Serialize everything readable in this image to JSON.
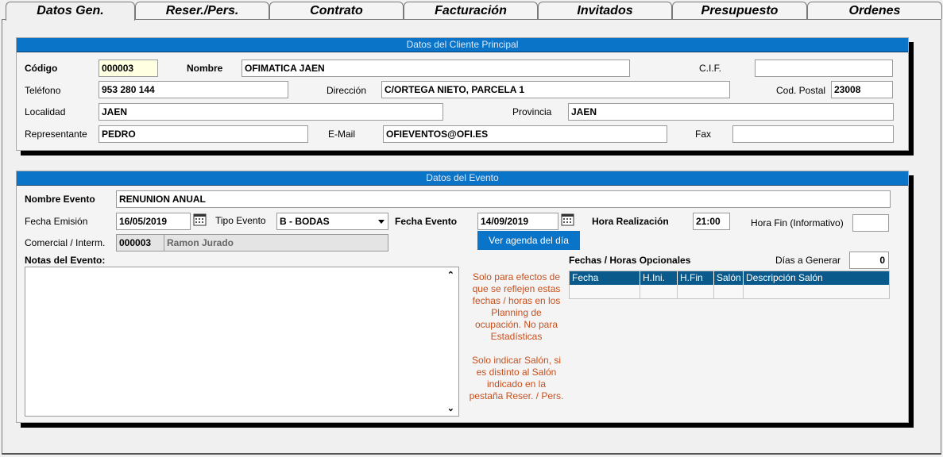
{
  "tabs": [
    "Datos Gen.",
    "Reser./Pers.",
    "Contrato",
    "Facturación",
    "Invitados",
    "Presupuesto",
    "Ordenes"
  ],
  "cliente": {
    "title": "Datos del Cliente Principal",
    "codigo_label": "Código",
    "codigo": "000003",
    "nombre_label": "Nombre",
    "nombre": "OFIMATICA JAEN",
    "cif_label": "C.I.F.",
    "cif": "",
    "telefono_label": "Teléfono",
    "telefono": "953 280 144",
    "direccion_label": "Dirección",
    "direccion": "C/ORTEGA NIETO, PARCELA 1",
    "cp_label": "Cod. Postal",
    "cp": "23008",
    "localidad_label": "Localidad",
    "localidad": "JAEN",
    "provincia_label": "Provincia",
    "provincia": "JAEN",
    "representante_label": "Representante",
    "representante": "PEDRO",
    "email_label": "E-Mail",
    "email": "OFIEVENTOS@OFI.ES",
    "fax_label": "Fax",
    "fax": ""
  },
  "evento": {
    "title": "Datos del Evento",
    "nombre_label": "Nombre Evento",
    "nombre": "RENUNION ANUAL",
    "fecha_emision_label": "Fecha Emisión",
    "fecha_emision": "16/05/2019",
    "tipo_label": "Tipo Evento",
    "tipo": "B - BODAS",
    "fecha_evento_label": "Fecha Evento",
    "fecha_evento": "14/09/2019",
    "hora_label": "Hora Realización",
    "hora": "21:00",
    "hora_fin_label": "Hora Fin (Informativo)",
    "hora_fin": "",
    "comercial_label": "Comercial / Interm.",
    "comercial_codigo": "000003",
    "comercial_nombre": "Ramon Jurado",
    "agenda_button": "Ver agenda del día",
    "notas_label": "Notas del Evento:",
    "notas": "",
    "note1": "Solo para efectos de\nque se reflejen estas\nfechas / horas en los\nPlanning de\nocupación. No para\nEstadísticas",
    "note2": "Solo indicar Salón, si\nes distinto al Salón\nindicado en la\npestaña Reser. / Pers.",
    "fechas_label": "Fechas / Horas Opcionales",
    "dias_label": "Días a Generar",
    "dias": "0",
    "columns": [
      "Fecha",
      "H.Ini.",
      "H.Fin",
      "Salón",
      "Descripción Salón"
    ]
  },
  "colors": {
    "header_blue": "#0a74c8",
    "grid_header": "#0a5a8c",
    "note_orange": "#c6501e",
    "yellow_field": "#ffffe1"
  }
}
